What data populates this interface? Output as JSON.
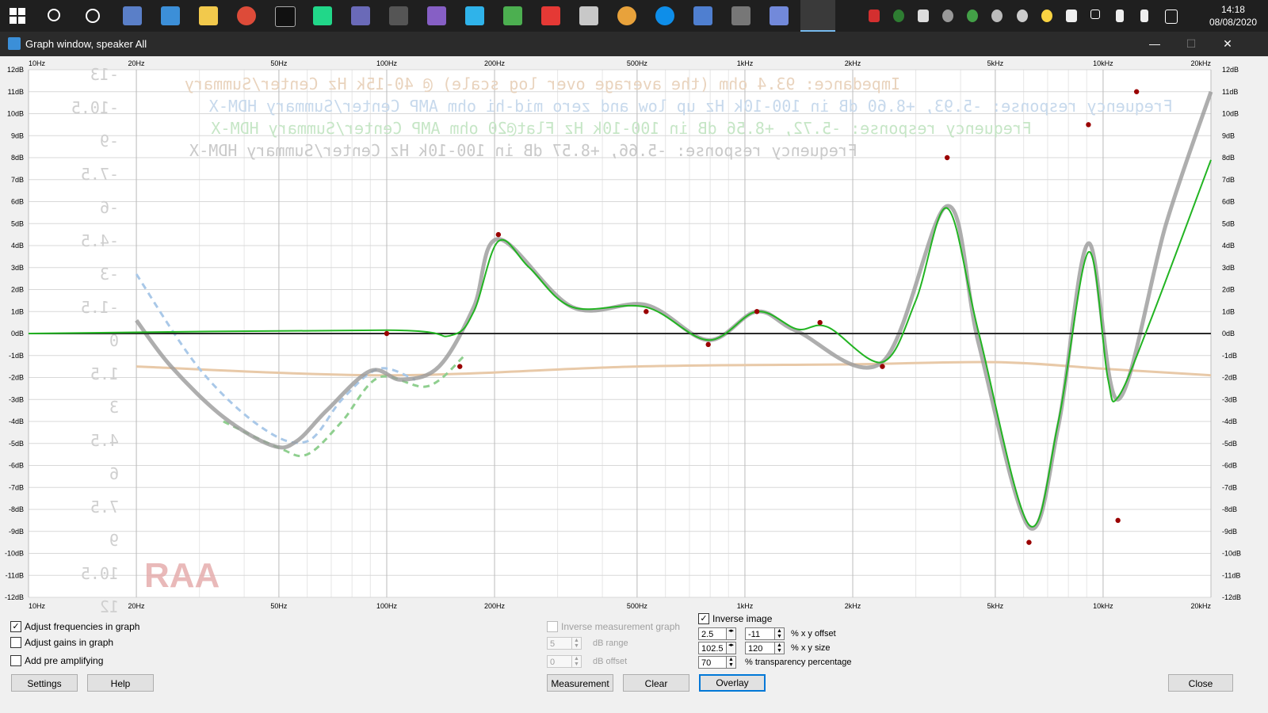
{
  "clock": {
    "time": "14:18",
    "date": "08/08/2020"
  },
  "window": {
    "title": "Graph window, speaker All",
    "minimize": "—",
    "maximize": "☐",
    "close": "✕"
  },
  "taskbar_icons": [
    "start-icon",
    "search-icon",
    "cortana-icon",
    "app-icon",
    "app-icon",
    "file-explorer-icon",
    "chrome-icon",
    "terminal-icon",
    "pycharm-icon",
    "app-icon",
    "app-icon",
    "visual-studio-icon",
    "app-icon",
    "app-icon",
    "app-icon",
    "app-icon",
    "app-icon",
    "teamviewer-icon",
    "app-icon",
    "app-icon",
    "discord-icon",
    "app-icon"
  ],
  "graph": {
    "freq_labels": [
      "10Hz",
      "20Hz",
      "50Hz",
      "100Hz",
      "200Hz",
      "500Hz",
      "1kHz",
      "2kHz",
      "5kHz",
      "10kHz",
      "20kHz"
    ],
    "db_labels_left": [
      "12dB",
      "11dB",
      "10dB",
      "9dB",
      "8dB",
      "7dB",
      "6dB",
      "5dB",
      "4dB",
      "3dB",
      "2dB",
      "1dB",
      "0dB",
      "-1dB",
      "-2dB",
      "-3dB",
      "-4dB",
      "-5dB",
      "-6dB",
      "-7dB",
      "-8dB",
      "-9dB",
      "-10dB",
      "-11dB",
      "-12dB"
    ],
    "db_labels_right": [
      "12dB",
      "11dB",
      "10dB",
      "9dB",
      "8dB",
      "7dB",
      "6dB",
      "5dB",
      "4dB",
      "3dB",
      "2dB",
      "1dB",
      "0dB",
      "-1dB",
      "-2dB",
      "-3dB",
      "-4dB",
      "-5dB",
      "-6dB",
      "-7dB",
      "-8dB",
      "-9dB",
      "-10dB",
      "-11dB",
      "-12dB"
    ],
    "overlay_lines": [
      "Impedance: 93.4 ohm (the average over log scale) @ 40-15k Hz  Center/Summary",
      "Frequency response: -5.93, +8.60 dB in 100-10k Hz  up low and zero mid-hi ohm  AMP Center/Summary  HDM-X",
      "Frequency response: -5.72, +8.56 dB in 100-10k Hz  Flat@20 ohm  AMP Center/Summary  HDM-X",
      "Frequency response: -5.66, +8.57 dB in 100-10k Hz  Center/Summary  HDM-X"
    ],
    "overlay_scale": [
      "-13",
      "-10.5",
      "-9",
      "-7.5",
      "-6",
      "-4.5",
      "-3",
      "-1.5",
      "0",
      "1.5",
      "3",
      "4.5",
      "6",
      "7.5",
      "9",
      "10.5",
      "12"
    ],
    "overlay_logo": "RAA",
    "colors": {
      "eq_curve": "#22b422",
      "points": "#9a0000",
      "measurement": "#9a9a9a",
      "impedance": "#e8c9a8",
      "dashed_blue": "#a9c8e8",
      "dashed_green": "#8fcf8f",
      "zero_line": "#2a2a2a"
    },
    "eq_points": [
      {
        "freq_hz": 100,
        "gain_db": 0.0
      },
      {
        "freq_hz": 160,
        "gain_db": -1.5
      },
      {
        "freq_hz": 205,
        "gain_db": 4.5
      },
      {
        "freq_hz": 530,
        "gain_db": 1.0
      },
      {
        "freq_hz": 790,
        "gain_db": -0.5
      },
      {
        "freq_hz": 1080,
        "gain_db": 1.0
      },
      {
        "freq_hz": 1620,
        "gain_db": 0.5
      },
      {
        "freq_hz": 2420,
        "gain_db": -1.5
      },
      {
        "freq_hz": 3670,
        "gain_db": 8.0
      },
      {
        "freq_hz": 6210,
        "gain_db": -9.5
      },
      {
        "freq_hz": 9100,
        "gain_db": 9.5
      },
      {
        "freq_hz": 11000,
        "gain_db": -8.5
      },
      {
        "freq_hz": 12400,
        "gain_db": 11.0
      }
    ],
    "eq_curve": [
      {
        "freq_hz": 10,
        "gain_db": 0.0
      },
      {
        "freq_hz": 100,
        "gain_db": 0.15
      },
      {
        "freq_hz": 150,
        "gain_db": -0.1
      },
      {
        "freq_hz": 175,
        "gain_db": 1.0
      },
      {
        "freq_hz": 205,
        "gain_db": 4.2
      },
      {
        "freq_hz": 250,
        "gain_db": 3.0
      },
      {
        "freq_hz": 330,
        "gain_db": 1.2
      },
      {
        "freq_hz": 530,
        "gain_db": 1.2
      },
      {
        "freq_hz": 790,
        "gain_db": -0.3
      },
      {
        "freq_hz": 1080,
        "gain_db": 1.0
      },
      {
        "freq_hz": 1400,
        "gain_db": 0.2
      },
      {
        "freq_hz": 1700,
        "gain_db": 0.3
      },
      {
        "freq_hz": 2420,
        "gain_db": -1.3
      },
      {
        "freq_hz": 3000,
        "gain_db": 1.5
      },
      {
        "freq_hz": 3670,
        "gain_db": 5.7
      },
      {
        "freq_hz": 4500,
        "gain_db": 0.0
      },
      {
        "freq_hz": 6210,
        "gain_db": -8.7
      },
      {
        "freq_hz": 7500,
        "gain_db": -4.0
      },
      {
        "freq_hz": 9100,
        "gain_db": 3.7
      },
      {
        "freq_hz": 10300,
        "gain_db": -2.0
      },
      {
        "freq_hz": 11000,
        "gain_db": -2.9
      },
      {
        "freq_hz": 13500,
        "gain_db": 0.5
      },
      {
        "freq_hz": 20000,
        "gain_db": 7.9
      }
    ],
    "measurement_curve": [
      {
        "freq_hz": 20,
        "gain_db": 0.6
      },
      {
        "freq_hz": 25,
        "gain_db": -1.5
      },
      {
        "freq_hz": 35,
        "gain_db": -3.8
      },
      {
        "freq_hz": 48,
        "gain_db": -5.1
      },
      {
        "freq_hz": 56,
        "gain_db": -4.9
      },
      {
        "freq_hz": 68,
        "gain_db": -3.5
      },
      {
        "freq_hz": 90,
        "gain_db": -1.7
      },
      {
        "freq_hz": 110,
        "gain_db": -2.1
      },
      {
        "freq_hz": 140,
        "gain_db": -1.5
      },
      {
        "freq_hz": 175,
        "gain_db": 1.2
      },
      {
        "freq_hz": 205,
        "gain_db": 4.3
      },
      {
        "freq_hz": 330,
        "gain_db": 1.2
      },
      {
        "freq_hz": 530,
        "gain_db": 1.3
      },
      {
        "freq_hz": 790,
        "gain_db": -0.3
      },
      {
        "freq_hz": 1080,
        "gain_db": 1.0
      },
      {
        "freq_hz": 1400,
        "gain_db": 0.1
      },
      {
        "freq_hz": 2420,
        "gain_db": -1.3
      },
      {
        "freq_hz": 3670,
        "gain_db": 5.8
      },
      {
        "freq_hz": 4500,
        "gain_db": -0.5
      },
      {
        "freq_hz": 6210,
        "gain_db": -8.8
      },
      {
        "freq_hz": 7500,
        "gain_db": -4.2
      },
      {
        "freq_hz": 9100,
        "gain_db": 4.1
      },
      {
        "freq_hz": 11000,
        "gain_db": -3.0
      },
      {
        "freq_hz": 15000,
        "gain_db": 5.0
      },
      {
        "freq_hz": 20000,
        "gain_db": 11.0
      }
    ],
    "impedance_curve": [
      {
        "freq_hz": 20,
        "gain_db": -1.5
      },
      {
        "freq_hz": 100,
        "gain_db": -1.9
      },
      {
        "freq_hz": 500,
        "gain_db": -1.5
      },
      {
        "freq_hz": 2000,
        "gain_db": -1.4
      },
      {
        "freq_hz": 5000,
        "gain_db": -1.3
      },
      {
        "freq_hz": 10000,
        "gain_db": -1.6
      },
      {
        "freq_hz": 20000,
        "gain_db": -1.9
      }
    ],
    "dashed_blue_curve": [
      {
        "freq_hz": 20,
        "gain_db": 2.7
      },
      {
        "freq_hz": 30,
        "gain_db": -1.6
      },
      {
        "freq_hz": 45,
        "gain_db": -4.3
      },
      {
        "freq_hz": 60,
        "gain_db": -4.9
      },
      {
        "freq_hz": 75,
        "gain_db": -3.0
      },
      {
        "freq_hz": 95,
        "gain_db": -1.6
      },
      {
        "freq_hz": 120,
        "gain_db": -2.1
      }
    ],
    "dashed_green_curve": [
      {
        "freq_hz": 35,
        "gain_db": -4.0
      },
      {
        "freq_hz": 50,
        "gain_db": -5.2
      },
      {
        "freq_hz": 60,
        "gain_db": -5.5
      },
      {
        "freq_hz": 75,
        "gain_db": -4.0
      },
      {
        "freq_hz": 95,
        "gain_db": -2.0
      },
      {
        "freq_hz": 130,
        "gain_db": -2.4
      },
      {
        "freq_hz": 165,
        "gain_db": -1.0
      }
    ]
  },
  "controls": {
    "adjust_frequencies": {
      "label": "Adjust frequencies in graph",
      "checked": true
    },
    "adjust_gains": {
      "label": "Adjust gains in graph",
      "checked": false
    },
    "add_pre_amplifying": {
      "label": "Add pre amplifying",
      "checked": false
    },
    "inverse_measurement_graph": {
      "label": "Inverse measurement graph",
      "checked": false
    },
    "db_range": {
      "value": "5",
      "label": "dB range"
    },
    "db_offset": {
      "value": "0",
      "label": "dB offset"
    },
    "inverse_image": {
      "label": "Inverse image",
      "checked": true
    },
    "xy_offset": {
      "x": "2.5",
      "y": "-11",
      "label": "% x y offset"
    },
    "xy_size": {
      "x": "102.5",
      "y": "120",
      "label": "% x y size"
    },
    "transparency": {
      "value": "70",
      "label": "% transparency percentage"
    }
  },
  "buttons": {
    "settings": "Settings",
    "help": "Help",
    "measurement": "Measurement",
    "clear": "Clear",
    "overlay": "Overlay",
    "close": "Close"
  },
  "check_glyph": "✓"
}
